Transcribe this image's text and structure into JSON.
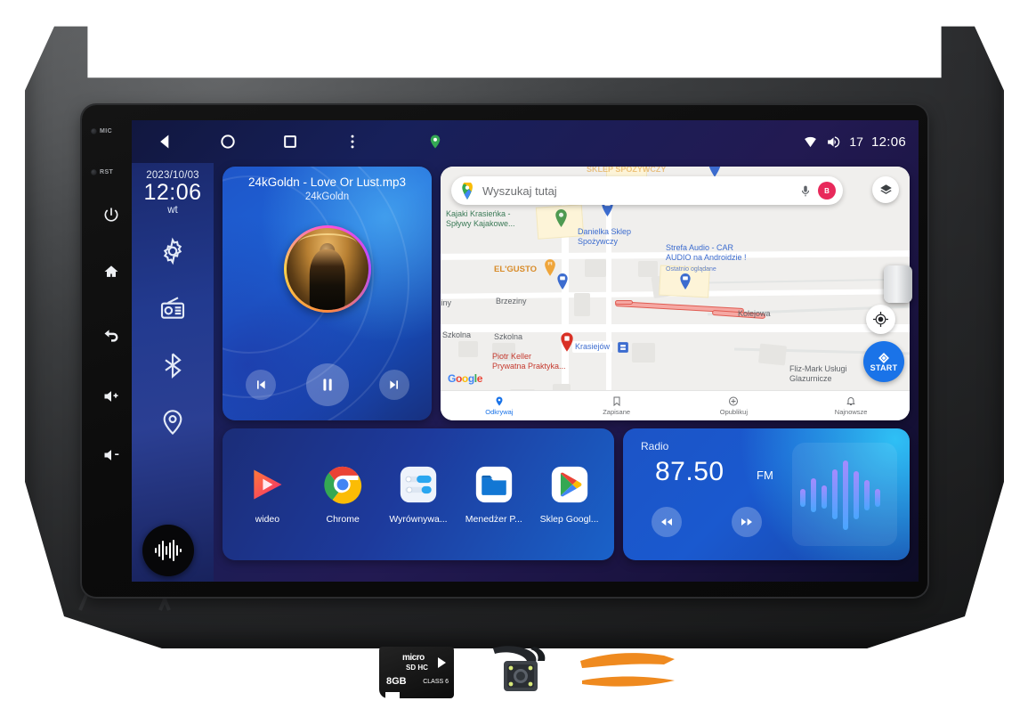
{
  "product": {
    "type": "car-radio-head-unit",
    "bezel_buttons": [
      {
        "name": "mic",
        "label": "MIC",
        "icon": "mic-icon"
      },
      {
        "name": "reset",
        "label": "RST",
        "icon": "reset-icon"
      },
      {
        "name": "power",
        "label": "",
        "icon": "power-icon"
      },
      {
        "name": "home",
        "label": "",
        "icon": "home-icon"
      },
      {
        "name": "back",
        "label": "",
        "icon": "back-arrow-icon"
      },
      {
        "name": "volume-up",
        "label": "",
        "icon": "volume-up-icon"
      },
      {
        "name": "volume-down",
        "label": "",
        "icon": "volume-down-icon"
      }
    ]
  },
  "statusbar": {
    "back_icon": "back-triangle-icon",
    "home_icon": "home-circle-icon",
    "recents_icon": "recents-square-icon",
    "overflow_icon": "more-vertical-icon",
    "gps_icon": "location-pin-icon",
    "wifi_icon": "wifi-icon",
    "volume_icon": "volume-icon",
    "volume_level": "17",
    "clock": "12:06"
  },
  "dock": {
    "date": "2023/10/03",
    "time": "12:06",
    "weekday": "wt",
    "icons": [
      {
        "name": "settings",
        "icon": "gear-icon"
      },
      {
        "name": "radio",
        "icon": "radio-icon"
      },
      {
        "name": "bluetooth",
        "icon": "bluetooth-icon"
      },
      {
        "name": "navigation",
        "icon": "location-pin-icon"
      }
    ],
    "assistant_icon": "voice-waveform-icon"
  },
  "music": {
    "title": "24kGoldn - Love Or Lust.mp3",
    "artist": "24kGoldn",
    "prev_icon": "skip-previous-icon",
    "play_icon": "pause-icon",
    "next_icon": "skip-next-icon"
  },
  "map": {
    "search_placeholder": "Wyszukaj tutaj",
    "search_value": "",
    "google_logo": "Google",
    "mic_icon": "microphone-icon",
    "avatar_initial": "B",
    "layers_icon": "layers-icon",
    "my_location_icon": "my-location-icon",
    "start_label": "START",
    "start_icon": "navigation-arrow-icon",
    "top_partial_label": "SKLEP SPOŻYWCZY",
    "places": [
      {
        "name": "Kajaki Krasieńka -\nSpływy Kajakowe...",
        "color": "#3b7a57"
      },
      {
        "name": "Danielka Sklep\nSpożywczy",
        "color": "#3c6ccf"
      },
      {
        "name": "Strefa Audio - CAR\nAUDIO na Androidzie !",
        "color": "#3c6ccf"
      },
      {
        "name": "Ostatnio oglądane",
        "color": "#5d7fcf"
      },
      {
        "name": "EL'GUSTO",
        "color": "#d88c2a"
      },
      {
        "name": "Brzeziny",
        "color": "#5f6368"
      },
      {
        "name": "Szkolna",
        "color": "#5f6368"
      },
      {
        "name": "Szkolna",
        "color": "#5f6368"
      },
      {
        "name": "Piotr Keller\nPrywatna Praktyka...",
        "color": "#c5392e"
      },
      {
        "name": "Krasiejów",
        "color": "#3c6ccf"
      },
      {
        "name": "Kolejowa",
        "color": "#5f6368"
      },
      {
        "name": "Fliz-Mark Usługi\nGlazurnicze",
        "color": "#5f6368"
      },
      {
        "name": "ziny",
        "color": "#5f6368"
      }
    ],
    "bottom_nav": [
      {
        "label": "Odkrywaj",
        "icon": "explore-pin-icon",
        "active": true
      },
      {
        "label": "Zapisane",
        "icon": "bookmark-icon",
        "active": false
      },
      {
        "label": "Opublikuj",
        "icon": "plus-circle-icon",
        "active": false
      },
      {
        "label": "Najnowsze",
        "icon": "bell-icon",
        "active": false
      }
    ]
  },
  "apps": [
    {
      "label": "wideo",
      "icon": "video-player-icon"
    },
    {
      "label": "Chrome",
      "icon": "chrome-icon"
    },
    {
      "label": "Wyrównywa...",
      "icon": "equalizer-icon"
    },
    {
      "label": "Menedżer P...",
      "icon": "file-manager-icon"
    },
    {
      "label": "Sklep Googl...",
      "icon": "play-store-icon"
    }
  ],
  "radio": {
    "title": "Radio",
    "frequency": "87.50",
    "band": "FM",
    "prev_icon": "rewind-icon",
    "next_icon": "fast-forward-icon",
    "waveform_icon": "audio-waveform-icon"
  },
  "accessories": [
    {
      "name": "microsd-card",
      "label": "micro",
      "sub": "SD HC",
      "capacity": "8GB",
      "class": "CLASS 6"
    },
    {
      "name": "rear-view-camera",
      "label": ""
    },
    {
      "name": "pry-tools",
      "label": ""
    }
  ],
  "colors": {
    "accent_blue": "#1a73e8",
    "widget_blue": "#1c54c6",
    "dock_blue": "#223a8f",
    "screen_bg": "#17205a",
    "bezel": "#3e4042"
  }
}
